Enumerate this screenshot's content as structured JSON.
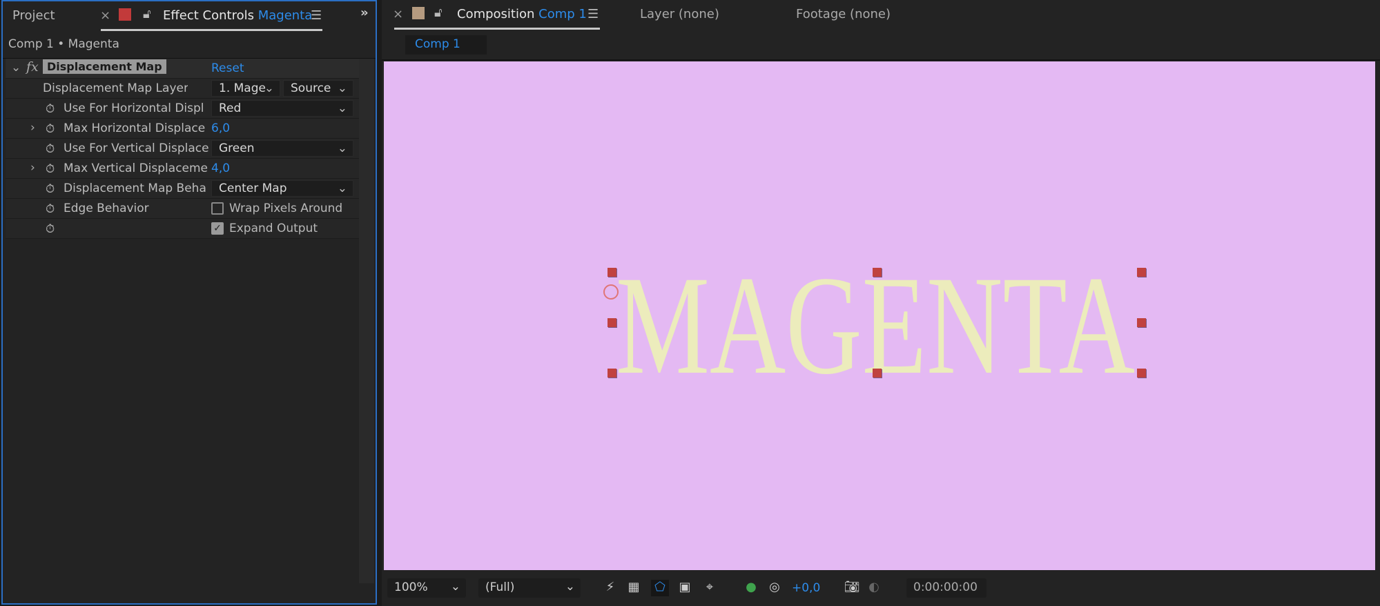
{
  "left_panel": {
    "tabs": {
      "project": "Project",
      "effect_controls": "Effect Controls",
      "effect_controls_layer": "Magenta"
    },
    "breadcrumb": "Comp 1 • Magenta",
    "effect": {
      "name": "Displacement Map",
      "reset": "Reset"
    },
    "rows": [
      {
        "label": "Displacement Map Layer",
        "value": "1. Mage",
        "value2": "Source"
      },
      {
        "label": "Use For Horizontal Displ",
        "value": "Red"
      },
      {
        "label": "Max Horizontal Displace",
        "value": "6,0"
      },
      {
        "label": "Use For Vertical Displace",
        "value": "Green"
      },
      {
        "label": "Max Vertical Displaceme",
        "value": "4,0"
      },
      {
        "label": "Displacement Map Beha",
        "value": "Center Map"
      },
      {
        "label": "Edge Behavior",
        "value": "Wrap Pixels Around",
        "checked": false
      },
      {
        "label": "",
        "value": "Expand Output",
        "checked": true
      }
    ]
  },
  "right_panel": {
    "tabs": {
      "composition": "Composition",
      "composition_name": "Comp 1",
      "layer": "Layer (none)",
      "footage": "Footage (none)"
    },
    "subtab": "Comp 1",
    "canvas": {
      "text": "MAGENTA",
      "bg_color": "#e4b9f3",
      "text_color": "#ececbc"
    },
    "toolbar": {
      "zoom": "100%",
      "resolution": "(Full)",
      "exposure": "+0,0",
      "timecode": "0:00:00:00"
    }
  },
  "colors": {
    "accent": "#2d8ceb",
    "label_red": "#c23a3a",
    "label_tan": "#b59b80"
  }
}
